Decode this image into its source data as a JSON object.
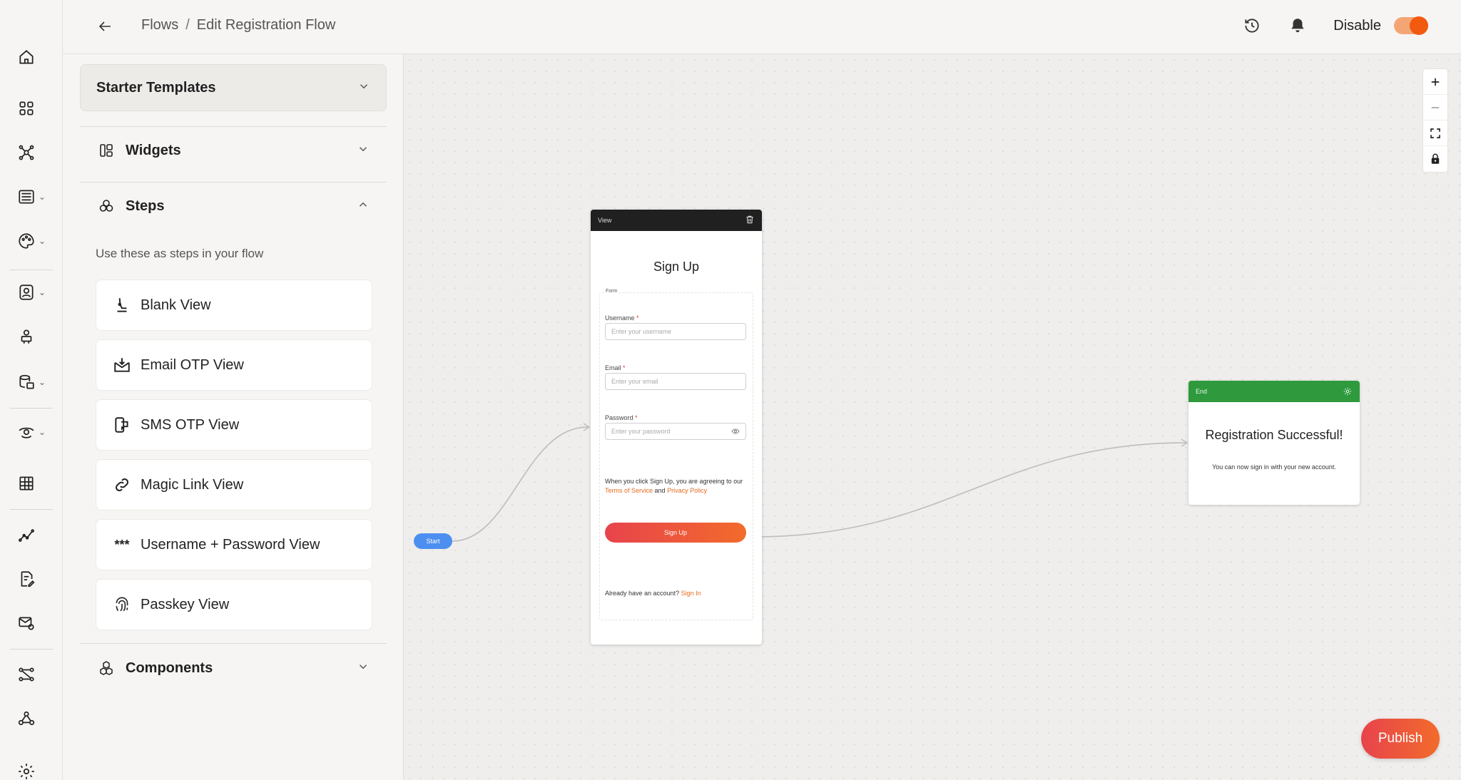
{
  "header": {
    "breadcrumb_root": "Flows",
    "breadcrumb_separator": "/",
    "breadcrumb_current": "Edit Registration Flow",
    "disable_label": "Disable",
    "toggle_on": true
  },
  "panel": {
    "starter_templates": "Starter Templates",
    "widgets": "Widgets",
    "steps": "Steps",
    "steps_hint": "Use these as steps in your flow",
    "components": "Components",
    "step_items": [
      {
        "label": "Blank View",
        "icon": "blank-view-icon"
      },
      {
        "label": "Email OTP View",
        "icon": "email-otp-icon"
      },
      {
        "label": "SMS OTP View",
        "icon": "sms-otp-icon"
      },
      {
        "label": "Magic Link View",
        "icon": "link-icon"
      },
      {
        "label": "Username + Password View",
        "icon": "asterisks-icon",
        "glyph": "***"
      },
      {
        "label": "Passkey View",
        "icon": "fingerprint-icon"
      }
    ]
  },
  "canvas": {
    "start_label": "Start",
    "view_node": {
      "header": "View",
      "title": "Sign Up",
      "form_tag": "Form",
      "username_label": "Username",
      "username_placeholder": "Enter your username",
      "email_label": "Email",
      "email_placeholder": "Enter your email",
      "password_label": "Password",
      "password_placeholder": "Enter your password",
      "required_mark": "*",
      "agree_prefix": "When you click Sign Up, you are agreeing to our",
      "terms_link": "Terms of Service",
      "agree_and": "and",
      "privacy_link": "Privacy Policy",
      "signup_button": "Sign Up",
      "have_account": "Already have an account?",
      "signin_link": "Sign In"
    },
    "end_node": {
      "header": "End",
      "title": "Registration Successful!",
      "subtitle": "You can now sign in with your new account."
    }
  },
  "actions": {
    "publish": "Publish"
  },
  "colors": {
    "accent": "#f15a0f",
    "start_node": "#4d8ff0",
    "end_header": "#2e9a3d",
    "view_header": "#202020",
    "link": "#e86a1c"
  }
}
